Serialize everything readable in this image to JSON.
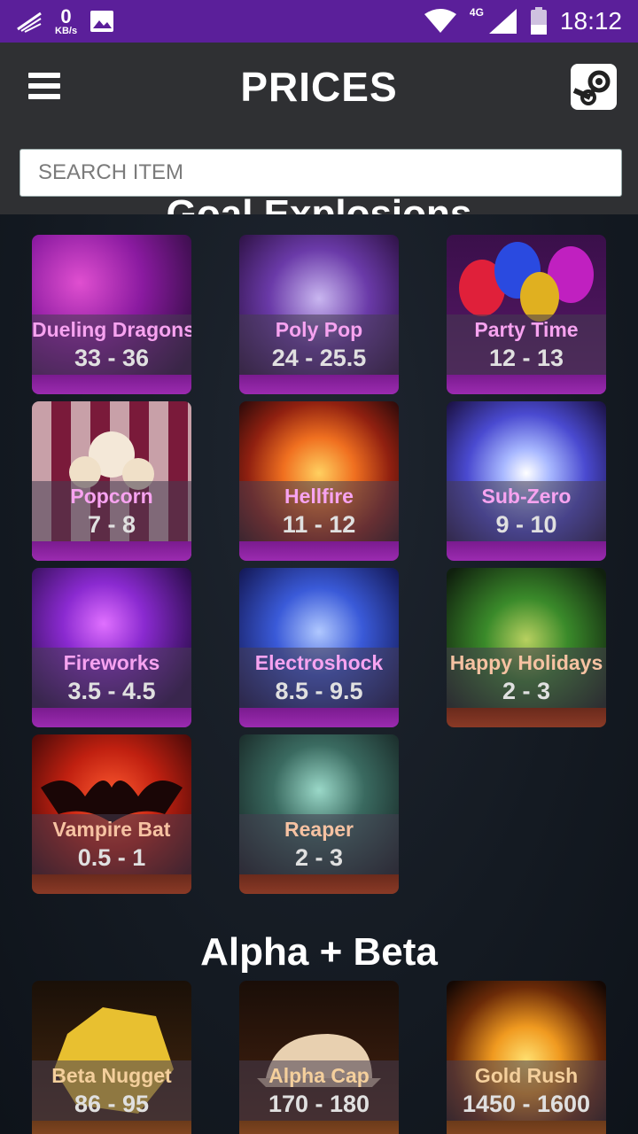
{
  "status_bar": {
    "speed_value": "0",
    "speed_unit": "KB/s",
    "network": "4G",
    "time": "18:12"
  },
  "header": {
    "title": "PRICES",
    "search_placeholder": "SEARCH ITEM"
  },
  "sections": [
    {
      "title": "Goal Explosions",
      "items": [
        {
          "name": "Dueling Dragons",
          "price": "33 - 36"
        },
        {
          "name": "Poly Pop",
          "price": "24 - 25.5"
        },
        {
          "name": "Party Time",
          "price": "12 - 13"
        },
        {
          "name": "Popcorn",
          "price": "7 - 8"
        },
        {
          "name": "Hellfire",
          "price": "11 - 12"
        },
        {
          "name": "Sub-Zero",
          "price": "9 - 10"
        },
        {
          "name": "Fireworks",
          "price": "3.5 - 4.5"
        },
        {
          "name": "Electroshock",
          "price": "8.5 - 9.5"
        },
        {
          "name": "Happy Holidays",
          "price": "2 - 3"
        },
        {
          "name": "Vampire Bat",
          "price": "0.5 - 1"
        },
        {
          "name": "Reaper",
          "price": "2 - 3"
        }
      ]
    },
    {
      "title": "Alpha + Beta",
      "items": [
        {
          "name": "Beta Nugget",
          "price": "86 - 95"
        },
        {
          "name": "Alpha Cap",
          "price": "170 - 180"
        },
        {
          "name": "Gold Rush",
          "price": "1450 - 1600"
        }
      ]
    }
  ],
  "colors": {
    "status_bar": "#5b1f9a",
    "app_bar": "#2f3033",
    "rare_stripe": "#9b2bb0",
    "uncommon_stripe": "#8a3a26"
  }
}
